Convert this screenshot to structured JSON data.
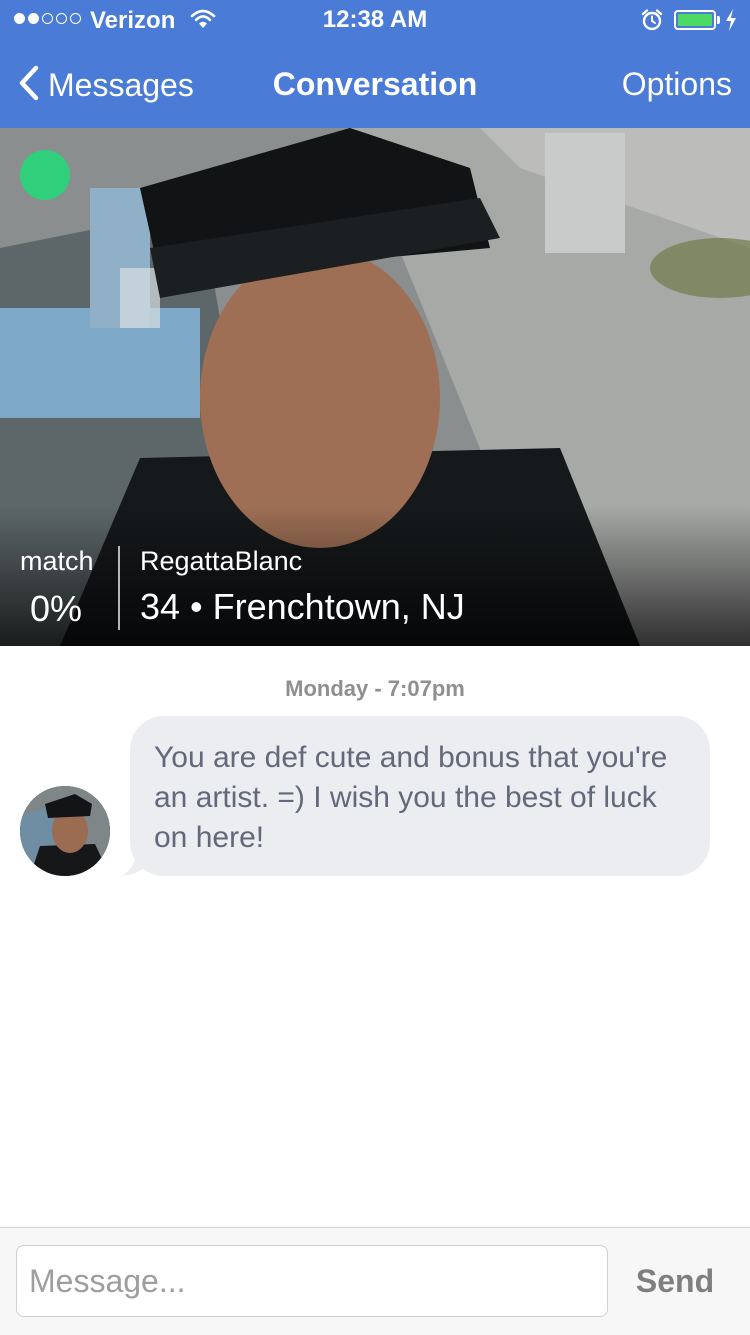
{
  "status_bar": {
    "signal": [
      true,
      true,
      false,
      false,
      false
    ],
    "carrier": "Verizon",
    "time": "12:38 AM",
    "battery_level": 1.0,
    "icons": [
      "wifi-icon",
      "alarm-icon",
      "battery-icon",
      "charging-bolt-icon"
    ]
  },
  "nav": {
    "back_label": "Messages",
    "title": "Conversation",
    "options_label": "Options"
  },
  "profile": {
    "match_label": "match",
    "match_value": "0%",
    "username": "RegattaBlanc",
    "age": "34",
    "separator": "•",
    "location": "Frenchtown, NJ",
    "online": true
  },
  "conversation": {
    "day_stamp": "Monday - 7:07pm",
    "messages": [
      {
        "from": "them",
        "text": "You are def cute and bonus that you're an artist. =) I wish you the best of luck on here!"
      }
    ]
  },
  "composer": {
    "placeholder": "Message...",
    "send_label": "Send"
  },
  "colors": {
    "nav_blue": "#4a7bd6",
    "online_green": "#2fcf7b",
    "bubble_bg": "#ebedf1",
    "bubble_text": "#63697a"
  }
}
